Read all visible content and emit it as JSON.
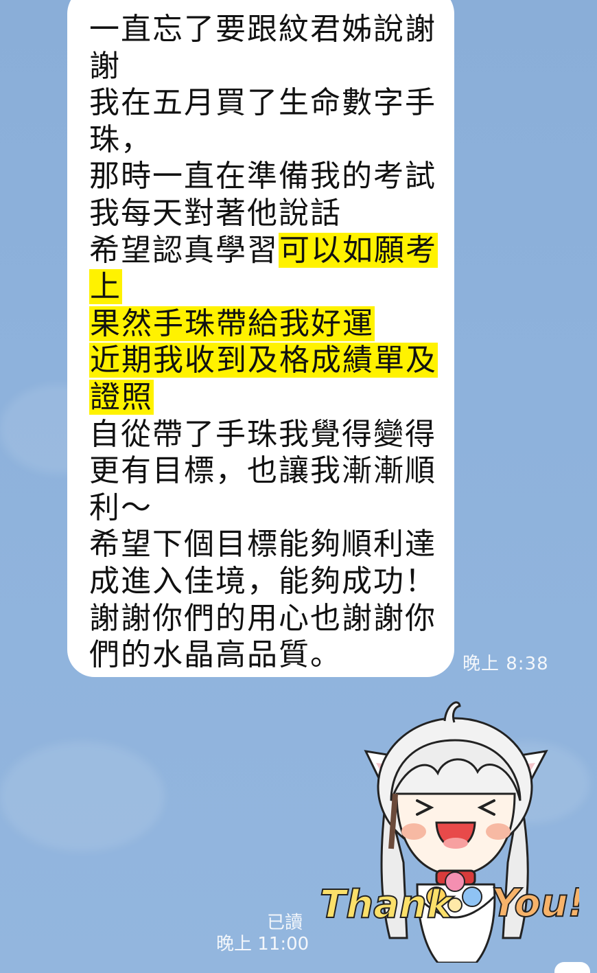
{
  "chat": {
    "received_message": {
      "lines": [
        "一直忘了要跟紋君姊說謝",
        "謝",
        "我在五月買了生命數字手",
        "珠，",
        "那時一直在準備我的考試",
        "我每天對著他說話",
        "希望認真學習",
        "可以如願考",
        "上",
        "果然手珠帶給我好運",
        "近期我收到及格成績單及",
        "證照",
        "自從帶了手珠我覺得變得",
        "更有目標，也讓我漸漸順",
        "利～",
        "希望下個目標能夠順利達",
        "成進入佳境，能夠成功！",
        "謝謝你們的用心也謝謝你",
        "們的水晶高品質。"
      ],
      "time": "晚上 8:38"
    },
    "sent_sticker": {
      "text_left": "Thank",
      "text_right": "You!",
      "read_label": "已讀",
      "time": "晚上 11:00"
    }
  },
  "colors": {
    "background": "#8eb2dc",
    "bubble": "#ffffff",
    "highlight": "#fff200",
    "meta_text": "#f4f7fb"
  }
}
